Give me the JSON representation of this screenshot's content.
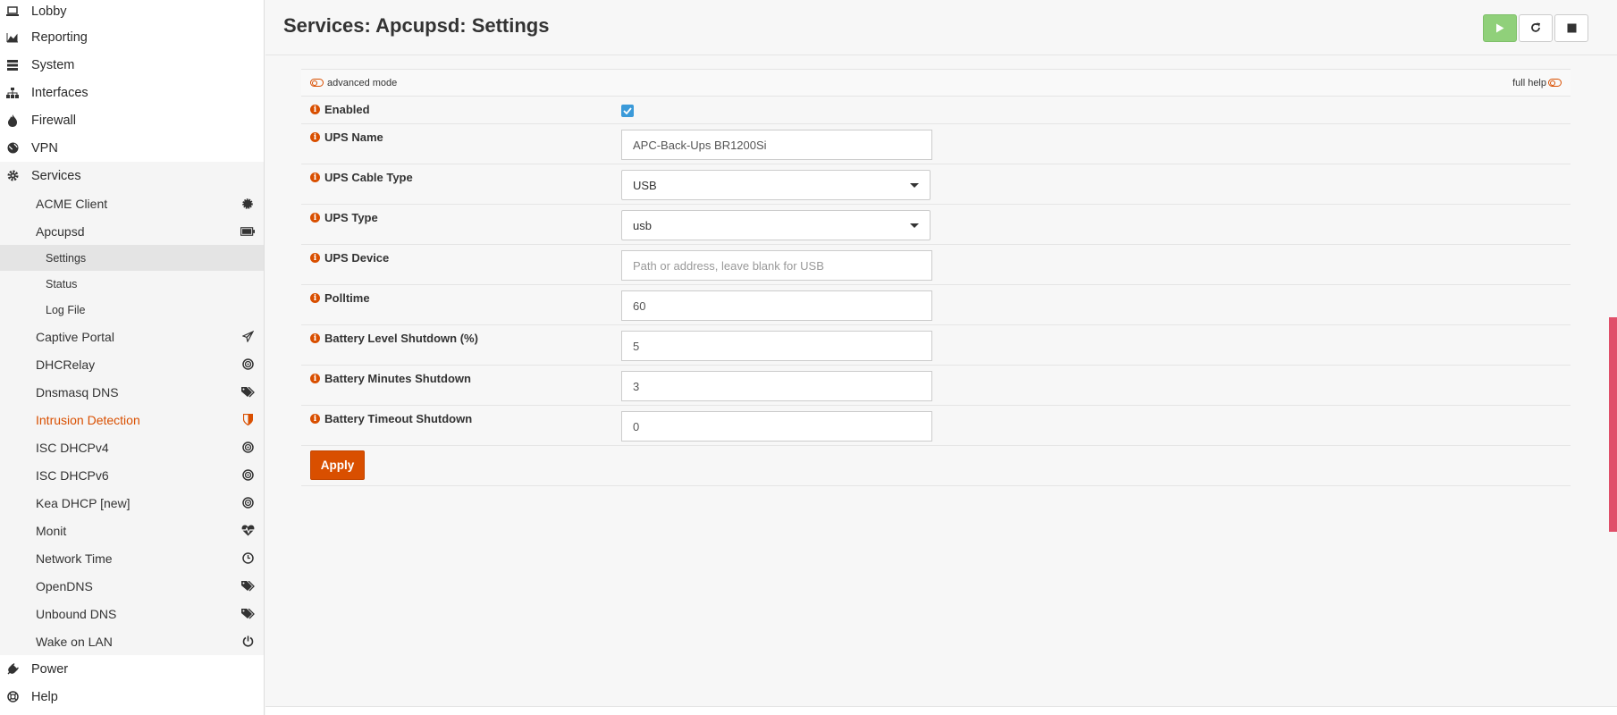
{
  "sidebar": {
    "top_items": [
      {
        "label": "Lobby",
        "icon": "laptop-icon"
      },
      {
        "label": "Reporting",
        "icon": "area-chart-icon"
      },
      {
        "label": "System",
        "icon": "server-icon"
      },
      {
        "label": "Interfaces",
        "icon": "sitemap-icon"
      },
      {
        "label": "Firewall",
        "icon": "fire-icon"
      },
      {
        "label": "VPN",
        "icon": "globe-icon"
      },
      {
        "label": "Services",
        "icon": "gear-icon"
      }
    ],
    "services_items": [
      {
        "label": "ACME Client",
        "icon": "certificate-icon"
      },
      {
        "label": "Apcupsd",
        "icon": "battery-icon"
      }
    ],
    "apcupsd_items": [
      {
        "label": "Settings"
      },
      {
        "label": "Status"
      },
      {
        "label": "Log File"
      }
    ],
    "services_items_2": [
      {
        "label": "Captive Portal",
        "icon": "paper-plane-icon"
      },
      {
        "label": "DHCRelay",
        "icon": "bullseye-icon"
      },
      {
        "label": "Dnsmasq DNS",
        "icon": "tags-icon"
      },
      {
        "label": "Intrusion Detection",
        "icon": "shield-icon"
      },
      {
        "label": "ISC DHCPv4",
        "icon": "bullseye-icon"
      },
      {
        "label": "ISC DHCPv6",
        "icon": "bullseye-icon"
      },
      {
        "label": "Kea DHCP [new]",
        "icon": "bullseye-icon"
      },
      {
        "label": "Monit",
        "icon": "heartbeat-icon"
      },
      {
        "label": "Network Time",
        "icon": "clock-icon"
      },
      {
        "label": "OpenDNS",
        "icon": "tags-icon"
      },
      {
        "label": "Unbound DNS",
        "icon": "tags-icon"
      },
      {
        "label": "Wake on LAN",
        "icon": "power-icon"
      }
    ],
    "bottom_items": [
      {
        "label": "Power",
        "icon": "plug-icon"
      },
      {
        "label": "Help",
        "icon": "life-ring-icon"
      }
    ]
  },
  "header": {
    "title": "Services: Apcupsd: Settings"
  },
  "modes": {
    "advanced": "advanced mode",
    "full_help": "full help"
  },
  "form": {
    "enabled": {
      "label": "Enabled",
      "checked": true
    },
    "ups_name": {
      "label": "UPS Name",
      "value": "APC-Back-Ups BR1200Si"
    },
    "ups_cable_type": {
      "label": "UPS Cable Type",
      "value": "USB"
    },
    "ups_type": {
      "label": "UPS Type",
      "value": "usb"
    },
    "ups_device": {
      "label": "UPS Device",
      "placeholder": "Path or address, leave blank for USB"
    },
    "polltime": {
      "label": "Polltime",
      "value": "60"
    },
    "battery_level": {
      "label": "Battery Level Shutdown (%)",
      "value": "5"
    },
    "battery_minutes": {
      "label": "Battery Minutes Shutdown",
      "value": "3"
    },
    "battery_timeout": {
      "label": "Battery Timeout Shutdown",
      "value": "0"
    }
  },
  "apply_label": "Apply",
  "colors": {
    "accent": "#d94f00",
    "start_button": "#90d07a",
    "checkbox": "#3b9ad9"
  }
}
